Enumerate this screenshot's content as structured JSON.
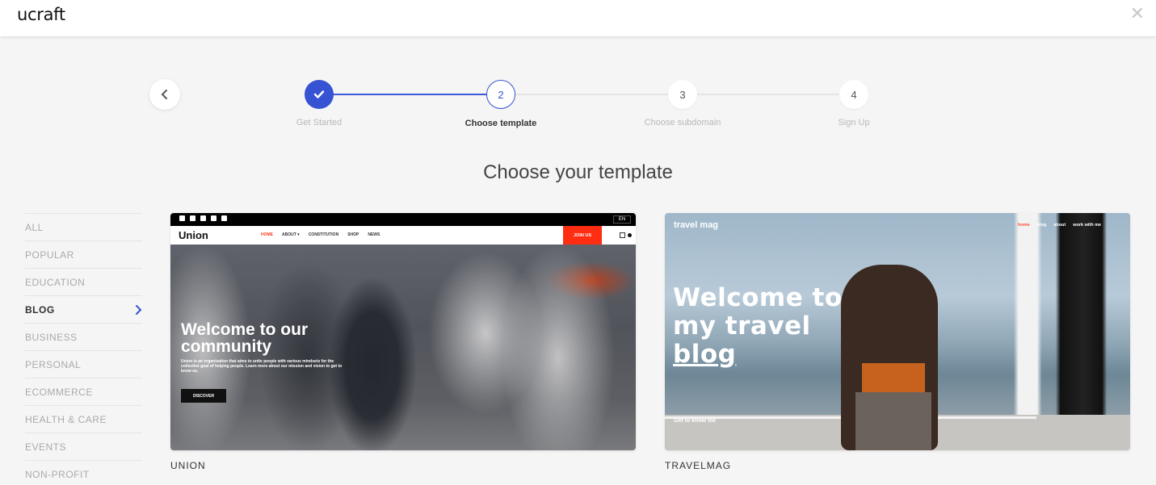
{
  "header": {
    "logo": "ucraft",
    "close_glyph": "✕"
  },
  "steps": [
    {
      "number": "",
      "label": "Get Started",
      "state": "done"
    },
    {
      "number": "2",
      "label": "Choose template",
      "state": "active"
    },
    {
      "number": "3",
      "label": "Choose subdomain",
      "state": "todo"
    },
    {
      "number": "4",
      "label": "Sign Up",
      "state": "todo"
    }
  ],
  "page": {
    "title": "Choose your template"
  },
  "categories": [
    {
      "label": "ALL"
    },
    {
      "label": "POPULAR"
    },
    {
      "label": "EDUCATION"
    },
    {
      "label": "BLOG",
      "active": true
    },
    {
      "label": "BUSINESS"
    },
    {
      "label": "PERSONAL"
    },
    {
      "label": "ECOMMERCE"
    },
    {
      "label": "HEALTH & CARE"
    },
    {
      "label": "EVENTS"
    },
    {
      "label": "NON-PROFIT"
    }
  ],
  "templates": [
    {
      "name": "UNION",
      "preview": {
        "brand": "Union",
        "lang": "EN",
        "menu": [
          "HOME",
          "ABOUT ▾",
          "CONSTITUTION",
          "SHOP",
          "NEWS"
        ],
        "cta": "JOIN US",
        "hero_title": "Welcome to our community",
        "hero_text": "Union is an organization that aims to unite people with various mindsets for the collective goal of helping people. Learn more about our mission and vision to get to know us.",
        "button": "DISCOVER"
      }
    },
    {
      "name": "TRAVELMAG",
      "preview": {
        "brand": "travel mag",
        "menu": [
          "home",
          "blog",
          "about",
          "work with me"
        ],
        "hero_title_line1": "Welcome to",
        "hero_title_line2": "my travel",
        "hero_title_line3": "blog",
        "cta": "Get to know me"
      }
    }
  ],
  "colors": {
    "accent": "#3553d3",
    "union_red": "#ff2d12",
    "travel_red": "#ff4a3a"
  }
}
